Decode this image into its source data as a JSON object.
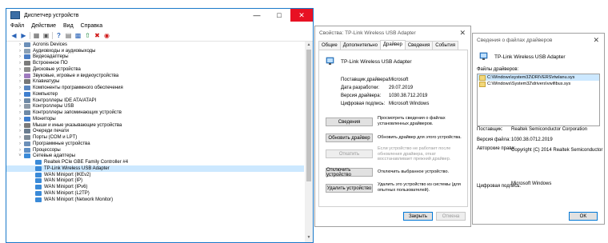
{
  "devmgr": {
    "title": "Диспетчер устройств",
    "menu": [
      "Файл",
      "Действие",
      "Вид",
      "Справка"
    ],
    "tree": [
      {
        "label": "Acronis Devices",
        "expanded": false
      },
      {
        "label": "Аудиовходы и аудиовыходы",
        "expanded": false
      },
      {
        "label": "Видеоадаптеры",
        "expanded": false
      },
      {
        "label": "Встроенное ПО",
        "expanded": false
      },
      {
        "label": "Дисковые устройства",
        "expanded": false
      },
      {
        "label": "Звуковые, игровые и видеоустройства",
        "expanded": false
      },
      {
        "label": "Клавиатуры",
        "expanded": false
      },
      {
        "label": "Компоненты программного обеспечения",
        "expanded": false
      },
      {
        "label": "Компьютер",
        "expanded": false
      },
      {
        "label": "Контроллеры IDE ATA/ATAPI",
        "expanded": false
      },
      {
        "label": "Контроллеры USB",
        "expanded": false
      },
      {
        "label": "Контроллеры запоминающих устройств",
        "expanded": false
      },
      {
        "label": "Мониторы",
        "expanded": false
      },
      {
        "label": "Мыши и иные указывающие устройства",
        "expanded": false
      },
      {
        "label": "Очереди печати",
        "expanded": false
      },
      {
        "label": "Порты (COM и LPT)",
        "expanded": false
      },
      {
        "label": "Программные устройства",
        "expanded": false
      },
      {
        "label": "Процессоры",
        "expanded": false
      },
      {
        "label": "Сетевые адаптеры",
        "expanded": true
      },
      {
        "label": "Realtek PCIe GBE Family Controller #4",
        "child": true
      },
      {
        "label": "TP-Link Wireless USB Adapter",
        "child": true,
        "selected": true
      },
      {
        "label": "WAN Miniport (IKEv2)",
        "child": true
      },
      {
        "label": "WAN Miniport (IP)",
        "child": true
      },
      {
        "label": "WAN Miniport (IPv6)",
        "child": true
      },
      {
        "label": "WAN Miniport (L2TP)",
        "child": true
      },
      {
        "label": "WAN Miniport (Network Monitor)",
        "child": true
      }
    ]
  },
  "props": {
    "title": "Свойства: TP-Link Wireless USB Adapter",
    "tabs": [
      "Общие",
      "Дополнительно",
      "Драйвер",
      "Сведения",
      "События"
    ],
    "active_tab": "Драйвер",
    "device_name": "TP-Link Wireless USB Adapter",
    "fields": [
      {
        "label": "Поставщик драйвера:",
        "value": "Microsoft"
      },
      {
        "label": "Дата разработки:",
        "value": "29.07.2019"
      },
      {
        "label": "Версия драйвера:",
        "value": "1030.38.712.2019"
      },
      {
        "label": "Цифровая подпись:",
        "value": "Microsoft Windows"
      }
    ],
    "actions": [
      {
        "button": "Сведения",
        "desc": "Просмотреть сведения о файлах установленных драйверов.",
        "disabled": false
      },
      {
        "button": "Обновить драйвер",
        "desc": "Обновить драйвер для этого устройства.",
        "disabled": false
      },
      {
        "button": "Откатить",
        "desc": "Если устройство не работает после обновления драйвера, откат восстанавливает прежний драйвер.",
        "disabled": true
      },
      {
        "button": "Отключить устройство",
        "desc": "Отключить выбранное устройство.",
        "disabled": false
      },
      {
        "button": "Удалить устройство",
        "desc": "Удалить это устройство из системы (для опытных пользователей).",
        "disabled": false
      }
    ],
    "close_label": "Закрыть",
    "cancel_label": "Отмена"
  },
  "files": {
    "title": "Сведения о файлах драйверов",
    "device_name": "TP-Link Wireless USB Adapter",
    "list_label": "Файлы драйверов:",
    "list": [
      {
        "path": "C:\\Windows\\system32\\DRIVERS\\rtwlanu.sys",
        "selected": true
      },
      {
        "path": "C:\\Windows\\System32\\drivers\\vwifibus.sys",
        "selected": false
      }
    ],
    "fields": [
      {
        "label": "Поставщик:",
        "value": "Realtek Semiconductor Corporation"
      },
      {
        "label": "Версия файла:",
        "value": "1030.38.0712.2019"
      },
      {
        "label": "Авторские права:",
        "value": "Copyright (C) 2014 Realtek Semiconductor"
      },
      {
        "label": "Цифровая подпись:",
        "value": "Microsoft Windows"
      }
    ],
    "ok_label": "OK"
  },
  "colors": {
    "accent": "#0078d7",
    "selection": "#cce8ff",
    "close_red": "#e81123"
  }
}
